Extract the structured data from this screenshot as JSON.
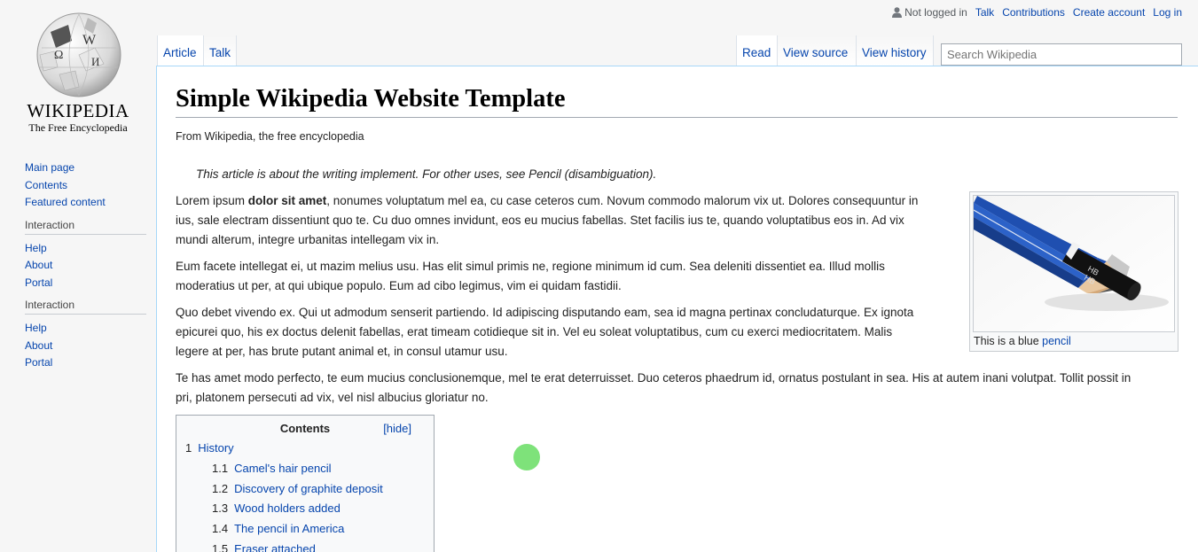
{
  "logo": {
    "wordmark": "WIKIPEDIA",
    "tagline": "The Free Encyclopedia",
    "globe_glyphs": [
      "Ω",
      "W",
      "И"
    ]
  },
  "sidebar": {
    "nav": [
      "Main page",
      "Contents",
      "Featured content"
    ],
    "groups": [
      {
        "heading": "Interaction",
        "items": [
          "Help",
          "About",
          "Portal"
        ]
      },
      {
        "heading": "Interaction",
        "items": [
          "Help",
          "About",
          "Portal"
        ]
      }
    ]
  },
  "personal": {
    "status": "Not logged in",
    "links": [
      "Talk",
      "Contributions",
      "Create account",
      "Log in"
    ]
  },
  "tabs": {
    "left": [
      "Article",
      "Talk"
    ],
    "right": [
      "Read",
      "View source",
      "View history"
    ]
  },
  "search": {
    "placeholder": "Search Wikipedia"
  },
  "article": {
    "title": "Simple Wikipedia Website Template",
    "site_sub": "From Wikipedia, the free encyclopedia",
    "hatnote": "This article is about the writing implement. For other uses, see Pencil (disambiguation).",
    "p1_start": "Lorem ipsum ",
    "p1_bold": "dolor sit amet",
    "p1_rest": ", nonumes voluptatum mel ea, cu case ceteros cum. Novum commodo malorum vix ut. Dolores consequuntur in",
    "p1_line2": "ius, sale electram dissentiunt quo te. Cu duo omnes invidunt, eos eu mucius fabellas. Stet facilis ius te, quando voluptatibus eos in. Ad vix",
    "p1_line3": "mundi alterum, integre urbanitas intellegam vix in.",
    "p2_line1": "Eum facete intellegat ei, ut mazim melius usu. Has elit simul primis ne, regione minimum id cum. Sea deleniti dissentiet ea. Illud mollis",
    "p2_line2": "moderatius ut per, at qui ubique populo. Eum ad cibo legimus, vim ei quidam fastidii.",
    "p3_line1": "Quo debet vivendo ex. Qui ut admodum senserit partiendo. Id adipiscing disputando eam, sea id magna pertinax concludaturque. Ex ignota",
    "p3_line2": "epicurei quo, his ex doctus delenit fabellas, erat timeam cotidieque sit in. Vel eu soleat voluptatibus, cum cu exerci mediocritatem. Malis",
    "p3_line3": "legere at per, has brute putant animal et, in consul utamur usu.",
    "p4_line1": "Te has amet modo perfecto, te eum mucius conclusionemque, mel te erat deterruisset. Duo ceteros phaedrum id, ornatus postulant in sea. His at autem inani volutpat. Tollit possit in",
    "p4_line2": "pri, platonem persecuti ad vix, vel nisl albucius gloriatur no."
  },
  "thumb": {
    "caption_prefix": "This is a blue ",
    "caption_link": "pencil",
    "pencil_label": "HB"
  },
  "toc": {
    "title": "Contents",
    "hide": "[hide]",
    "items": [
      {
        "num": "1",
        "label": "History",
        "level": 1
      },
      {
        "num": "1.1",
        "label": "Camel's hair pencil",
        "level": 2
      },
      {
        "num": "1.2",
        "label": "Discovery of graphite deposit",
        "level": 2
      },
      {
        "num": "1.3",
        "label": "Wood holders added",
        "level": 2
      },
      {
        "num": "1.4",
        "label": "The pencil in America",
        "level": 2
      },
      {
        "num": "1.5",
        "label": "Eraser attached",
        "level": 2
      }
    ]
  },
  "colors": {
    "link": "#0645ad",
    "content_border": "#a7d7f9",
    "cursor": "#7ee27a"
  }
}
